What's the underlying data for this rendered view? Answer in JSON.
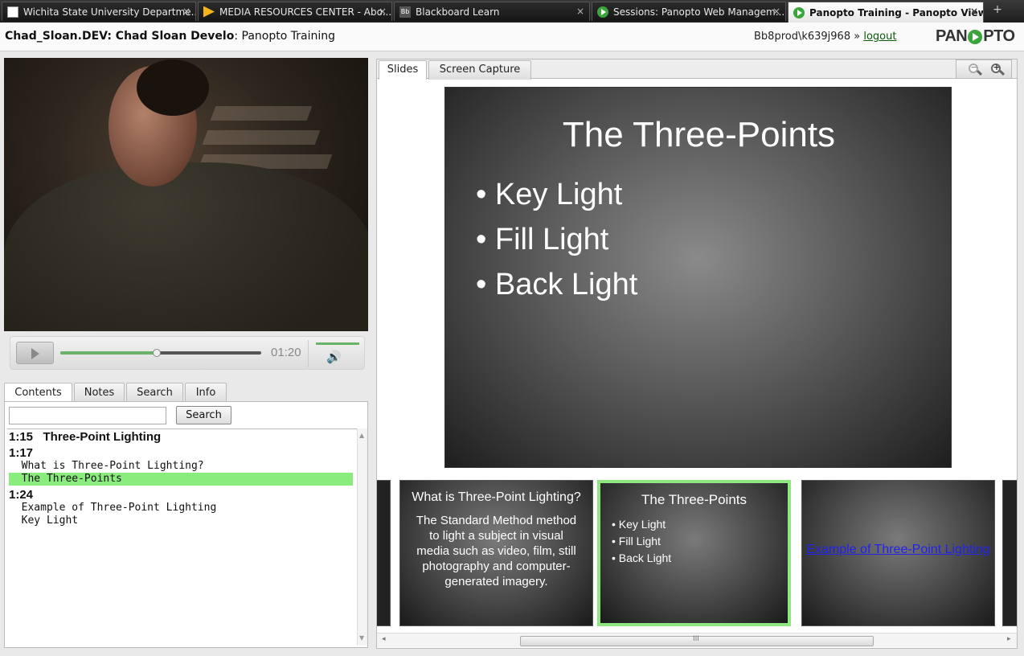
{
  "browser": {
    "tabs": [
      {
        "label": "Wichita State University Departme...",
        "icon": "document-icon"
      },
      {
        "label": "MEDIA RESOURCES CENTER - Abo...",
        "icon": "mrc-icon"
      },
      {
        "label": "Blackboard Learn",
        "icon": "blackboard-icon"
      },
      {
        "label": "Sessions: Panopto Web Managem...",
        "icon": "panopto-icon"
      },
      {
        "label": "Panopto Training - Panopto View...",
        "icon": "panopto-icon"
      }
    ],
    "tab_close": "×",
    "bb_glyph": "Bb",
    "new_tab": "+"
  },
  "header": {
    "title_bold": "Chad_Sloan.DEV: Chad Sloan Develo",
    "title_rest": ": Panopto Training",
    "user": "Bb8prod\\k639j968 »",
    "logout": "logout",
    "logo_left": "PAN",
    "logo_right": "PTO"
  },
  "player": {
    "time": "01:20",
    "progress_fraction": 0.48,
    "volume_fraction": 1.0,
    "volume_glyph": "🔊"
  },
  "left_tabs": [
    "Contents",
    "Notes",
    "Search",
    "Info"
  ],
  "contents": {
    "search_placeholder": "",
    "search_button": "Search",
    "rows": [
      {
        "text": "1:15   Three-Point Lighting",
        "kind": "time"
      },
      {
        "text": "1:17",
        "kind": "time"
      },
      {
        "text": "  What is Three-Point Lighting?",
        "kind": "item"
      },
      {
        "text": "  The Three-Points",
        "kind": "item",
        "selected": true
      },
      {
        "text": "1:24",
        "kind": "time"
      },
      {
        "text": "  Example of Three-Point Lighting",
        "kind": "item"
      },
      {
        "text": "  Key Light",
        "kind": "item"
      }
    ]
  },
  "right_tabs": [
    "Slides",
    "Screen Capture"
  ],
  "zoom": {
    "out": "−",
    "in": "+"
  },
  "main_slide": {
    "title": "The Three-Points",
    "bullets": [
      "• Key Light",
      "• Fill Light",
      "• Back Light"
    ]
  },
  "thumbnails": [
    {
      "title": "What is Three-Point Lighting?",
      "body": "The Standard Method method to light a subject in visual media such as video, film, still photography and computer-generated imagery."
    },
    {
      "title": "The Three-Points",
      "bullets": [
        "• Key Light",
        "• Fill Light",
        "• Back Light"
      ],
      "selected": true
    },
    {
      "link": "Example of Three-Point Lighting"
    }
  ],
  "scrollbar": {
    "grip": "III",
    "left": "◂",
    "right": "▸",
    "up": "▲",
    "down": "▼"
  }
}
